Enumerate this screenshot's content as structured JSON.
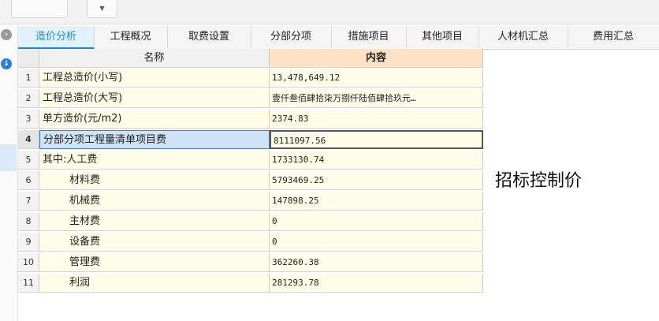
{
  "toolbar": {
    "dropdown_icon": "caret-down"
  },
  "left_strip": {
    "icons": [
      "collapse-circle-icon",
      "download-circle-icon"
    ]
  },
  "tabs": [
    {
      "label": "造价分析",
      "active": true
    },
    {
      "label": "工程概况"
    },
    {
      "label": "取费设置"
    },
    {
      "label": "分部分项"
    },
    {
      "label": "措施项目"
    },
    {
      "label": "其他项目"
    },
    {
      "label": "人材机汇总"
    },
    {
      "label": "费用汇总"
    }
  ],
  "table": {
    "headers": {
      "name": "名称",
      "content": "内容"
    },
    "rows": [
      {
        "num": "1",
        "name": "工程总造价(小写)",
        "value": "13,478,649.12"
      },
      {
        "num": "2",
        "name": "工程总造价(大写)",
        "value": "壹仟叁佰肆拾柒万捌仟陆佰肆拾玖元…"
      },
      {
        "num": "3",
        "name": "单方造价(元/m2)",
        "value": "2374.83"
      },
      {
        "num": "4",
        "name": "分部分项工程量清单项目费",
        "value": "8111097.56",
        "selected": true
      },
      {
        "num": "5",
        "name": "其中:人工费",
        "value": "1733130.74"
      },
      {
        "num": "6",
        "name": "材料费",
        "value": "5793469.25",
        "indent": true
      },
      {
        "num": "7",
        "name": "机械费",
        "value": "147898.25",
        "indent": true
      },
      {
        "num": "8",
        "name": "主材费",
        "value": "0",
        "indent": true
      },
      {
        "num": "9",
        "name": "设备费",
        "value": "0",
        "indent": true
      },
      {
        "num": "10",
        "name": "管理费",
        "value": "362260.38",
        "indent": true
      },
      {
        "num": "11",
        "name": "利润",
        "value": "281293.78",
        "indent": true
      }
    ]
  },
  "side_label": "招标控制价"
}
